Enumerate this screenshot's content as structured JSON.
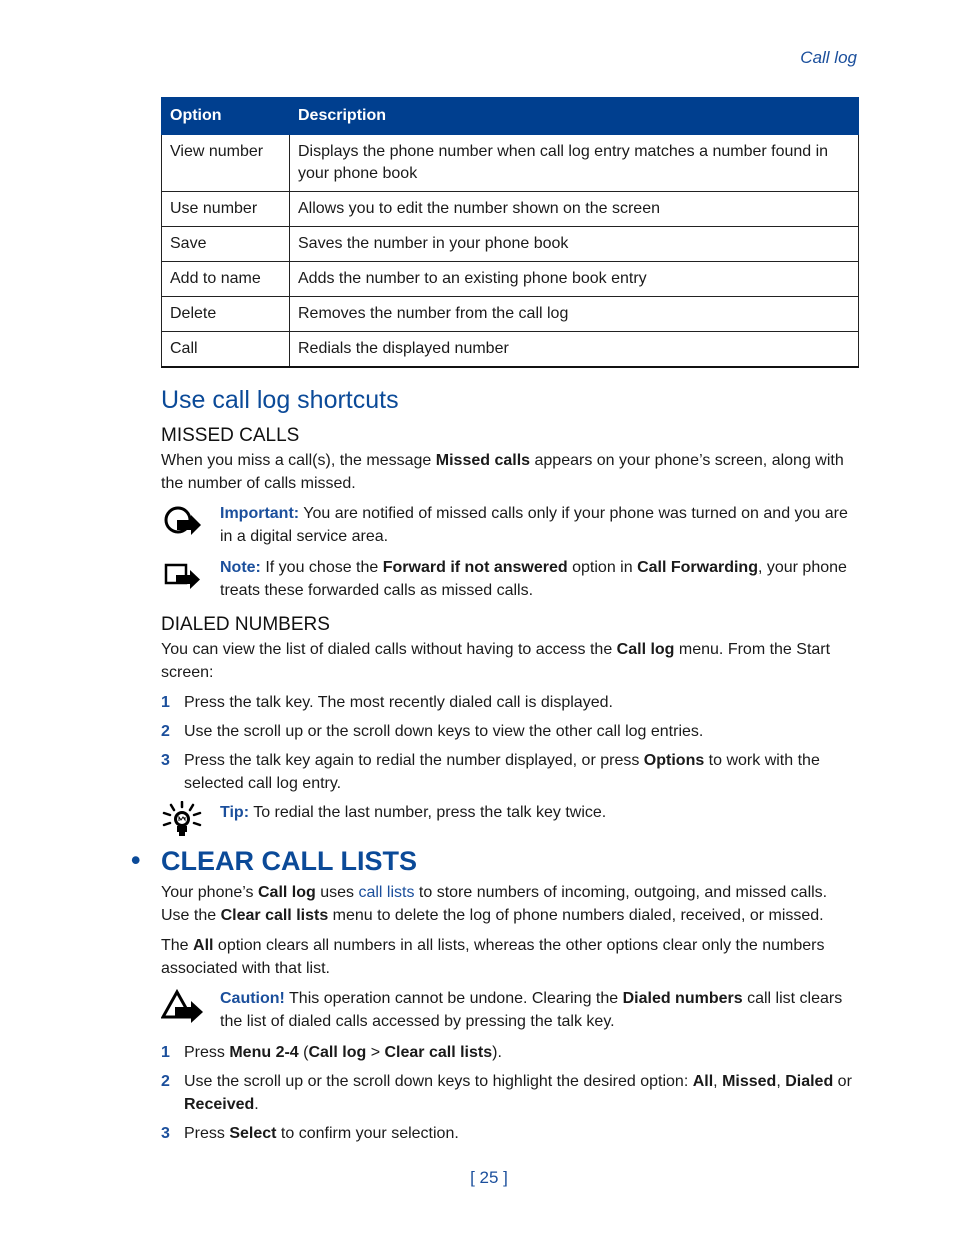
{
  "running_head": "Call log",
  "table": {
    "headers": [
      "Option",
      "Description"
    ],
    "rows": [
      {
        "option": "View number",
        "description": "Displays the phone number when call log entry matches a number found in your phone book"
      },
      {
        "option": "Use number",
        "description": "Allows you to edit the number shown on the screen"
      },
      {
        "option": "Save",
        "description": "Saves the number in your phone book"
      },
      {
        "option": "Add to name",
        "description": "Adds the number to an existing phone book entry"
      },
      {
        "option": "Delete",
        "description": "Removes the number from the call log"
      },
      {
        "option": "Call",
        "description": "Redials the displayed number"
      }
    ]
  },
  "shortcuts": {
    "title": "Use call log shortcuts",
    "missed": {
      "heading": "MISSED CALLS",
      "p1": "When you miss a call(s), the message ",
      "p1_bold": "Missed calls",
      "p1_end": " appears on your phone’s screen, along with the number of calls missed.",
      "important_label": "Important:",
      "important_text": " You are notified of missed calls only if your phone was turned on and you are in a digital service area.",
      "note_label": "Note:",
      "note_t1": " If you chose the ",
      "note_b1": "Forward if not answered",
      "note_t2": " option in ",
      "note_b2": "Call Forwarding",
      "note_t3": ", your phone treats these forwarded calls as missed calls."
    },
    "dialed": {
      "heading": "DIALED NUMBERS",
      "p1": "You can view the list of dialed calls without having to access the ",
      "p1_bold": "Call log",
      "p1_end": " menu. From the Start screen:",
      "steps": [
        {
          "num": "1",
          "text": "Press the talk key. The most recently dialed call is displayed."
        },
        {
          "num": "2",
          "text": "Use the scroll up or the scroll down keys to view the other call log entries."
        },
        {
          "num": "3",
          "t1": "Press the talk key again to redial the number displayed, or press ",
          "b1": "Options",
          "t2": " to work with the selected call log entry."
        }
      ],
      "tip_label": "Tip:",
      "tip_text": " To redial the last number, press the talk key twice."
    }
  },
  "clear": {
    "bullet": "•",
    "title": "CLEAR CALL LISTS",
    "p1_t1": "Your phone’s ",
    "p1_b1": "Call log",
    "p1_t2": " uses ",
    "p1_link": "call lists",
    "p1_t3": " to store numbers of incoming, outgoing, and missed calls. Use the ",
    "p1_b2": "Clear call lists",
    "p1_t4": " menu to delete the log of phone numbers dialed, received, or missed.",
    "p2_t1": "The ",
    "p2_b1": "All",
    "p2_t2": " option clears all numbers in all lists, whereas the other options clear only the numbers associated with that list.",
    "caution_label": "Caution!",
    "caution_t1": " This operation cannot be undone. Clearing the ",
    "caution_b1": "Dialed numbers",
    "caution_t2": " call list clears the list of dialed calls accessed by pressing the talk key.",
    "steps": [
      {
        "num": "1",
        "t1": "Press ",
        "b1": "Menu 2-4",
        "t2": " (",
        "b2": "Call log",
        "t3": " > ",
        "b3": "Clear call lists",
        "t4": ")."
      },
      {
        "num": "2",
        "t1": "Use the scroll up or the scroll down keys to highlight the desired option: ",
        "b1": "All",
        "t2": ", ",
        "b2": "Missed",
        "t3": ", ",
        "b3": "Dialed",
        "t4": " or ",
        "b4": "Received",
        "t5": "."
      },
      {
        "num": "3",
        "t1": "Press ",
        "b1": "Select",
        "t2": " to confirm your selection."
      }
    ]
  },
  "page_number": "[ 25 ]",
  "colors": {
    "header_bg": "#003f8f",
    "heading": "#0b4a98",
    "accent": "#1b4f9c"
  }
}
